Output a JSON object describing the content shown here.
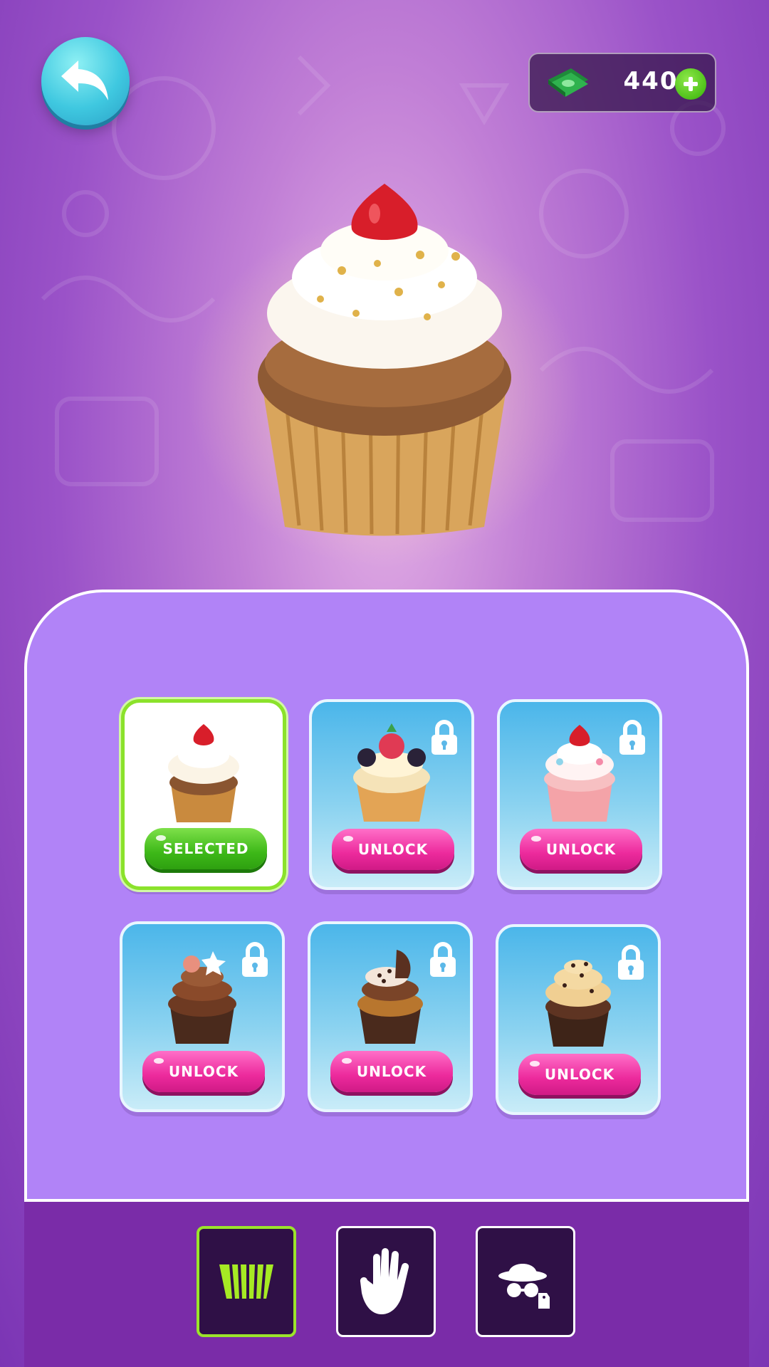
{
  "header": {
    "back_icon": "back-arrow-icon",
    "currency": {
      "icon": "cash-icon",
      "value": "440",
      "add_icon": "plus-icon"
    }
  },
  "preview": {
    "item": "vanilla-cupcake-with-cherry"
  },
  "shop": {
    "items": [
      {
        "name": "vanilla-cherry-cupcake",
        "status": "selected",
        "button_label": "SELECTED",
        "locked": false
      },
      {
        "name": "berry-cupcake",
        "status": "locked",
        "button_label": "UNLOCK",
        "locked": true
      },
      {
        "name": "pink-cherry-cupcake",
        "status": "locked",
        "button_label": "UNLOCK",
        "locked": true
      },
      {
        "name": "chocolate-swirl-cupcake",
        "status": "locked",
        "button_label": "UNLOCK",
        "locked": true
      },
      {
        "name": "cookies-cream-cupcake",
        "status": "locked",
        "button_label": "UNLOCK",
        "locked": true
      },
      {
        "name": "chocolate-chip-cupcake",
        "status": "locked",
        "button_label": "UNLOCK",
        "locked": true
      }
    ]
  },
  "tabs": [
    {
      "name": "cupcake-liner-tab",
      "icon": "cupcake-liner-icon",
      "active": true
    },
    {
      "name": "hand-tab",
      "icon": "hand-icon",
      "active": false
    },
    {
      "name": "character-tab",
      "icon": "hat-glasses-icon",
      "active": false
    }
  ],
  "colors": {
    "accent_green": "#8be22b",
    "unlock_pink": "#ec2a9c",
    "panel_purple": "#b183f7",
    "tabbar_purple": "#7a2ca8"
  }
}
